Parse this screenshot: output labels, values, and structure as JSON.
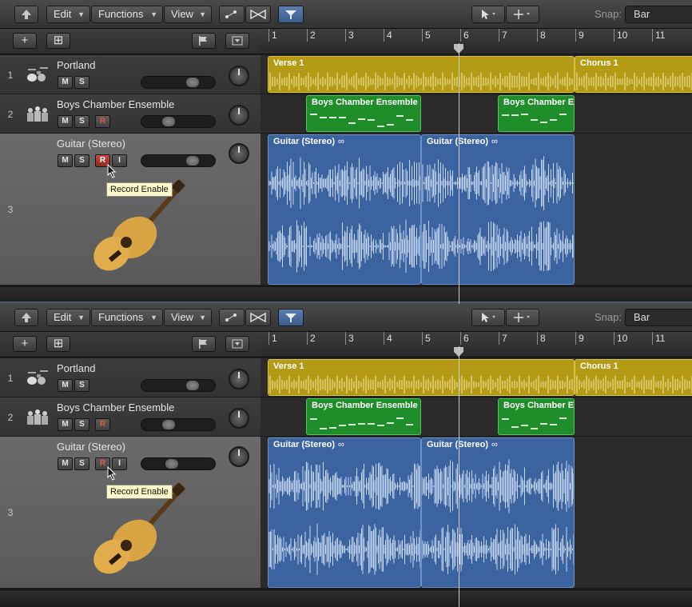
{
  "toolbar": {
    "edit_label": "Edit",
    "functions_label": "Functions",
    "view_label": "View",
    "snap_label": "Snap:",
    "snap_value": "Bar",
    "caret": "▼"
  },
  "header": {
    "add_track_label": "+",
    "folder_label": "⊞"
  },
  "ruler": {
    "bars": [
      "1",
      "2",
      "3",
      "4",
      "5",
      "6",
      "7",
      "8",
      "9",
      "10",
      "11"
    ]
  },
  "tracks": [
    {
      "number": "1",
      "name": "Portland",
      "icon": "drum-kit-icon"
    },
    {
      "number": "2",
      "name": "Boys Chamber Ensemble",
      "icon": "choir-icon"
    },
    {
      "number": "3",
      "name": "Guitar (Stereo)",
      "icon": "acoustic-guitar-icon"
    }
  ],
  "buttons": {
    "mute": "M",
    "solo": "S",
    "record": "R",
    "input": "I"
  },
  "regions": {
    "verse": "Verse 1",
    "chorus": "Chorus 1",
    "choir_a": "Boys Chamber Ensemble",
    "choir_b": "Boys Chamber Ensemble",
    "guitar_a": "Guitar (Stereo)",
    "guitar_b": "Guitar (Stereo)",
    "loop_glyph": "∞"
  },
  "tooltip": "Record Enable",
  "panels": [
    {
      "record_state": "enabled"
    },
    {
      "record_state": "disabled"
    }
  ],
  "colors": {
    "audio_region": "#3b63a0",
    "midi_region": "#1f8e2a",
    "drummer_region": "#b59a16",
    "record_active": "#c24a3a"
  }
}
